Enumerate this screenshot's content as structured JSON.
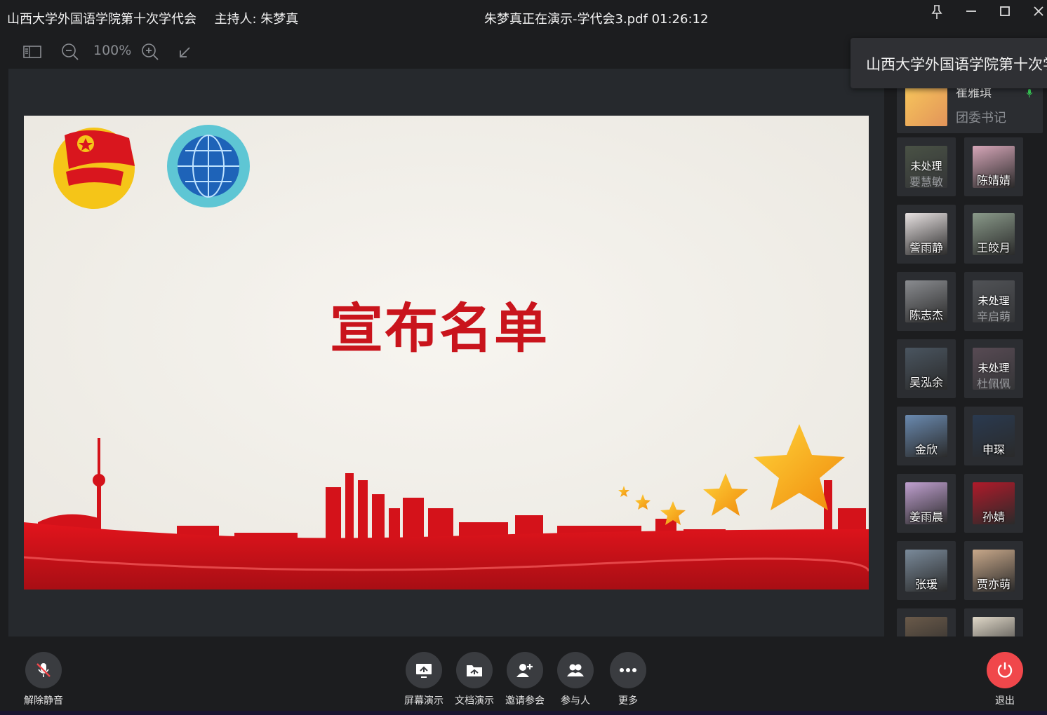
{
  "window": {
    "meeting_title": "山西大学外国语学院第十次学代会",
    "host_label": "主持人: 朱梦真",
    "presenter_status": "朱梦真正在演示-学代会3.pdf 01:26:12"
  },
  "toolbar": {
    "zoom_level": "100%"
  },
  "slide": {
    "title": "宣布名单",
    "accent_color": "#c9141c"
  },
  "tooltip": {
    "text": "山西大学外国语学院第十次学代会"
  },
  "host_card": {
    "name": "崔雅琪",
    "role": "团委书记"
  },
  "participants": [
    {
      "name": "要慧敏",
      "status": "未处理",
      "pending": true
    },
    {
      "name": "陈婧婧",
      "pending": false
    },
    {
      "name": "訾雨静",
      "pending": false
    },
    {
      "name": "王皎月",
      "pending": false
    },
    {
      "name": "陈志杰",
      "pending": false
    },
    {
      "name": "辛启萌",
      "status": "未处理",
      "pending": true
    },
    {
      "name": "吴泓余",
      "pending": false
    },
    {
      "name": "杜佩佩",
      "status": "未处理",
      "pending": true
    },
    {
      "name": "金欣",
      "pending": false
    },
    {
      "name": "申琛",
      "pending": false
    },
    {
      "name": "姜雨晨",
      "pending": false
    },
    {
      "name": "孙婧",
      "pending": false
    },
    {
      "name": "张瑗",
      "pending": false
    },
    {
      "name": "贾亦萌",
      "pending": false
    },
    {
      "name": "",
      "pending": false
    },
    {
      "name": "",
      "pending": false
    }
  ],
  "controls": {
    "unmute": "解除静音",
    "screen_share": "屏幕演示",
    "doc_share": "文档演示",
    "invite": "邀请参会",
    "participants": "参与人",
    "more": "更多",
    "exit": "退出"
  },
  "colors": {
    "background": "#1c1d1f",
    "stage": "#26292d",
    "exit_button": "#f0474b"
  }
}
